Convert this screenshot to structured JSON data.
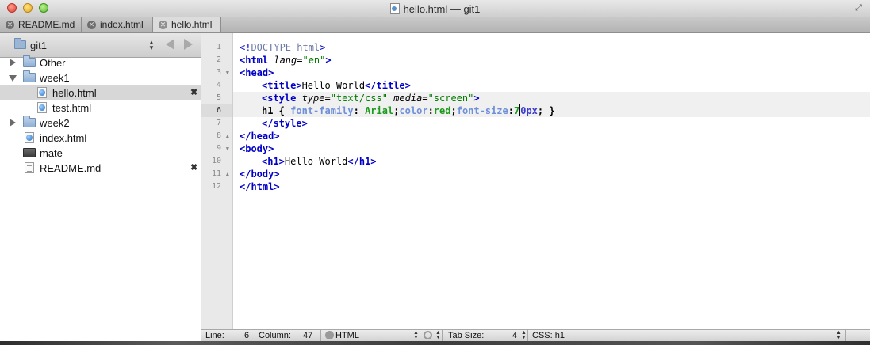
{
  "window": {
    "title": "hello.html — git1"
  },
  "tabs": [
    {
      "label": "README.md",
      "active": false
    },
    {
      "label": "index.html",
      "active": false
    },
    {
      "label": "hello.html",
      "active": true
    }
  ],
  "sidebar": {
    "project": "git1",
    "items": [
      {
        "label": "Other",
        "kind": "folder",
        "expanded": false,
        "depth": 0
      },
      {
        "label": "week1",
        "kind": "folder",
        "expanded": true,
        "depth": 0
      },
      {
        "label": "hello.html",
        "kind": "html-file",
        "depth": 1,
        "selected": true,
        "open": true
      },
      {
        "label": "test.html",
        "kind": "html-file",
        "depth": 1
      },
      {
        "label": "week2",
        "kind": "folder",
        "expanded": false,
        "depth": 0
      },
      {
        "label": "index.html",
        "kind": "html-file",
        "depth": 0
      },
      {
        "label": "mate",
        "kind": "mate-file",
        "depth": 0
      },
      {
        "label": "README.md",
        "kind": "md-file",
        "depth": 0,
        "open": true
      }
    ],
    "close_glyph": "✖"
  },
  "gutter": {
    "lines": [
      "1",
      "2",
      "3",
      "4",
      "5",
      "6",
      "7",
      "8",
      "9",
      "10",
      "11",
      "12"
    ],
    "current_line": "6"
  },
  "code": {
    "l1a": "<!",
    "l1b": "DOCTYPE html",
    "l1c": ">",
    "l2_tag": "<html",
    "l2_attr": " lang",
    "l2_eq": "=",
    "l2_val": "\"en\"",
    "l2_end": ">",
    "l3": "<head>",
    "l4_open": "<title>",
    "l4_text": "Hello World",
    "l4_close": "</title>",
    "l5_tag": "<style",
    "l5_attr1": " type",
    "l5_eq1": "=",
    "l5_val1": "\"text/css\"",
    "l5_attr2": " media",
    "l5_eq2": "=",
    "l5_val2": "\"screen\"",
    "l5_end": ">",
    "l6_sel": "h1",
    "l6_brace_open": " { ",
    "l6_p1": "font-family",
    "l6_c1": ": ",
    "l6_v1": "Arial",
    "l6_s1": ";",
    "l6_p2": "color",
    "l6_c2": ":",
    "l6_v2": "red",
    "l6_s2": ";",
    "l6_p3": "font-size",
    "l6_c3": ":",
    "l6_v3a": "7",
    "l6_v3b": "0px",
    "l6_end": "; }",
    "l7": "</style>",
    "l8": "</head>",
    "l9": "<body>",
    "l10_open": "<h1>",
    "l10_text": "Hello World",
    "l10_close": "</h1>",
    "l11": "</body>",
    "l12": "</html>"
  },
  "statusbar": {
    "line_label": "Line:",
    "line_value": "6",
    "column_label": "Column:",
    "column_value": "47",
    "language": "HTML",
    "tab_size_label": "Tab Size:",
    "tab_size_value": "4",
    "symbol": "CSS: h1"
  }
}
